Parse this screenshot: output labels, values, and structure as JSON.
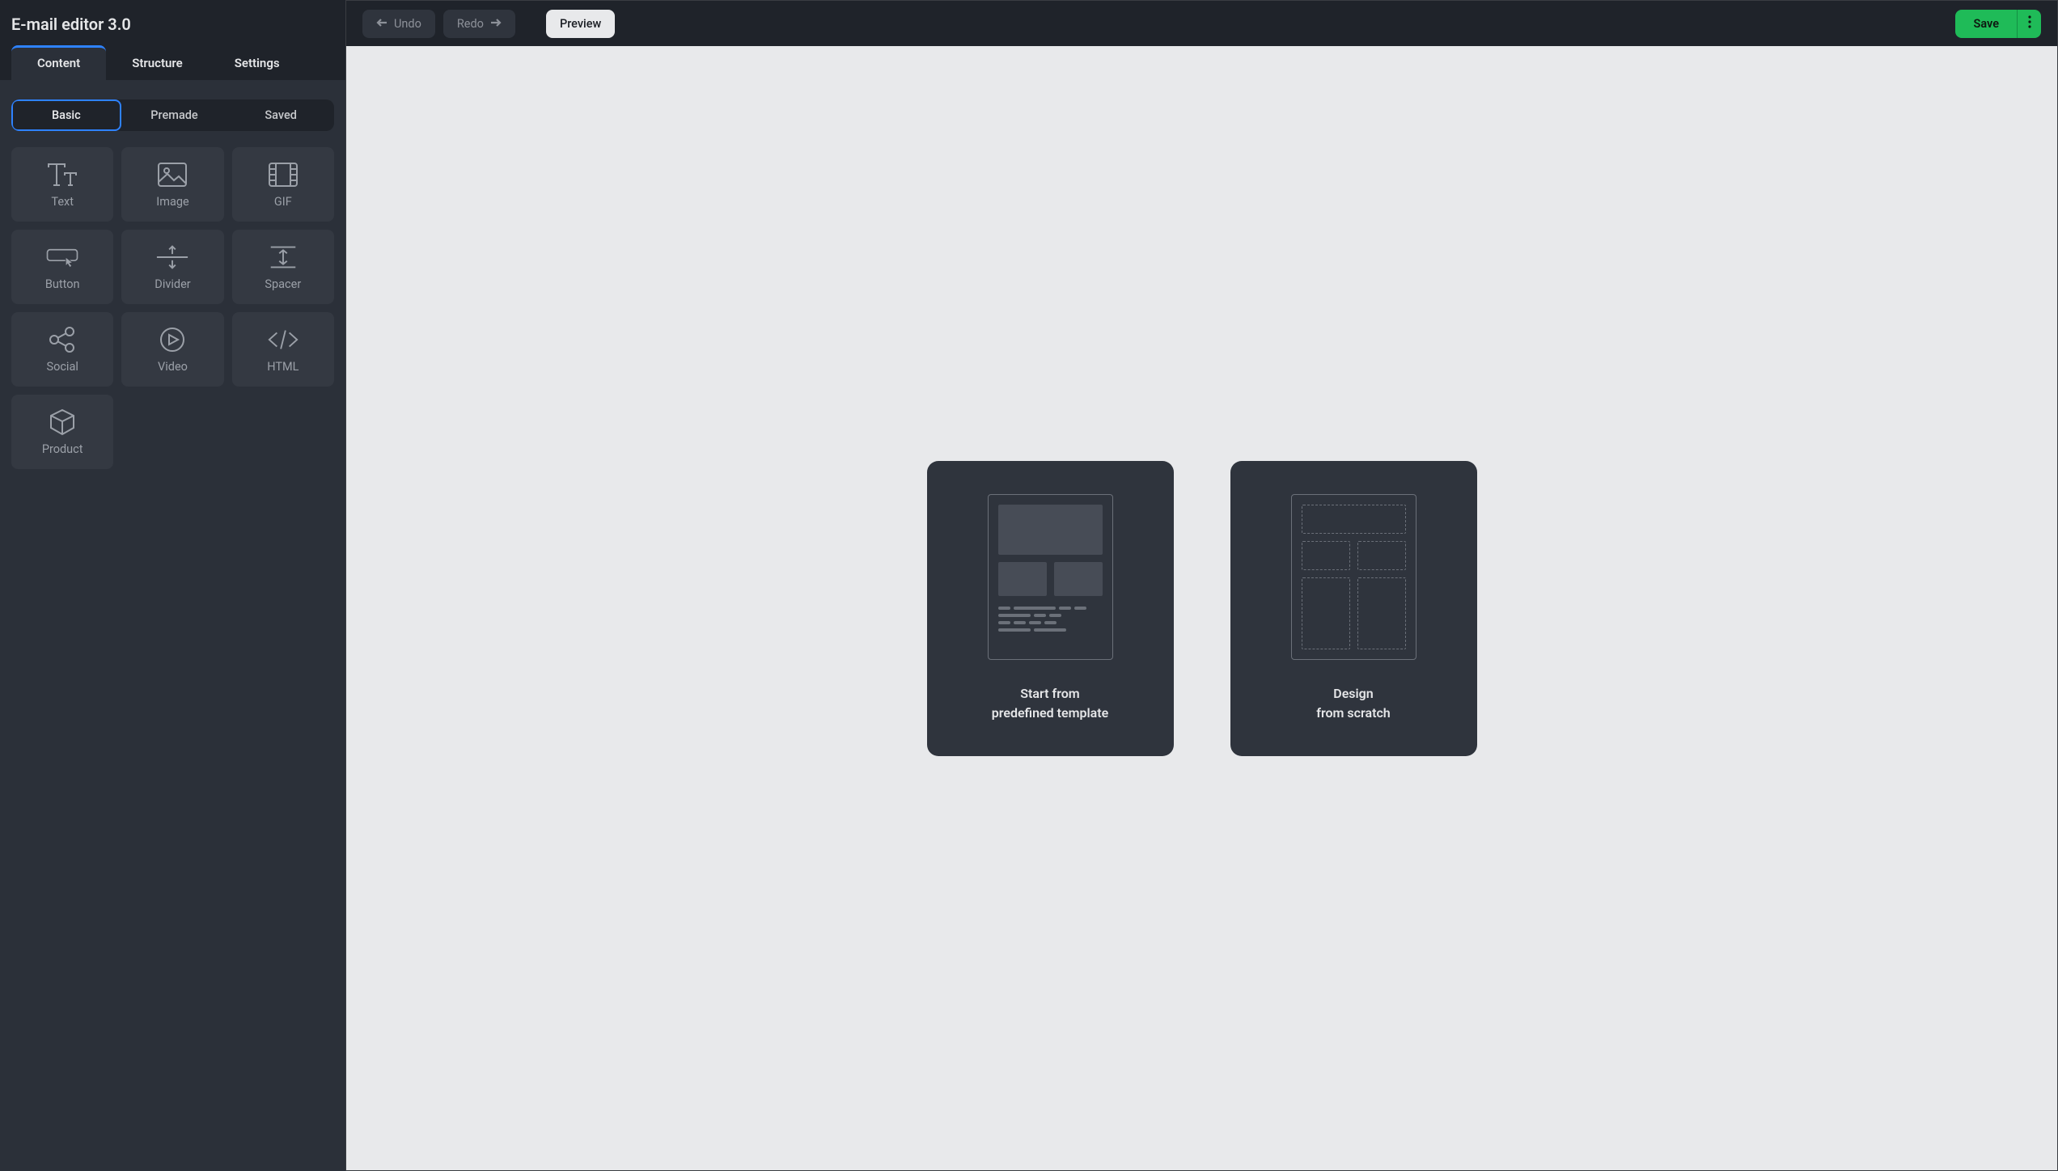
{
  "app_title": "E-mail editor 3.0",
  "primary_tabs": {
    "content": "Content",
    "structure": "Structure",
    "settings": "Settings"
  },
  "sub_tabs": {
    "basic": "Basic",
    "premade": "Premade",
    "saved": "Saved"
  },
  "blocks": {
    "text": "Text",
    "image": "Image",
    "gif": "GIF",
    "button": "Button",
    "divider": "Divider",
    "spacer": "Spacer",
    "social": "Social",
    "video": "Video",
    "html": "HTML",
    "product": "Product"
  },
  "toolbar": {
    "undo": "Undo",
    "redo": "Redo",
    "preview": "Preview",
    "save": "Save"
  },
  "cards": {
    "template_line1": "Start from",
    "template_line2": "predefined template",
    "scratch_line1": "Design",
    "scratch_line2": "from scratch"
  }
}
